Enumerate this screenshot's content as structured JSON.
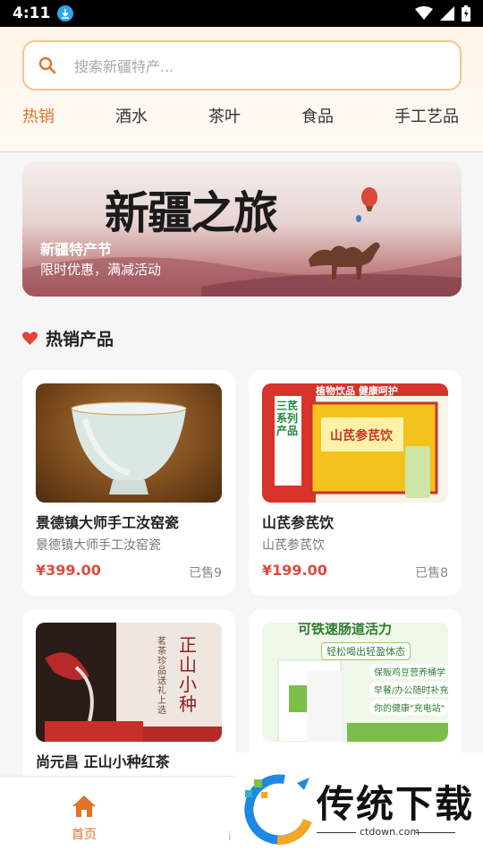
{
  "status_bar": {
    "time": "4:11"
  },
  "search": {
    "placeholder": "搜索新疆特产..."
  },
  "tabs": [
    {
      "label": "热销",
      "active": true
    },
    {
      "label": "酒水",
      "active": false
    },
    {
      "label": "茶叶",
      "active": false
    },
    {
      "label": "食品",
      "active": false
    },
    {
      "label": "手工艺品",
      "active": false
    }
  ],
  "banner": {
    "calligraphy": "新疆之旅",
    "title": "新疆特产节",
    "subtitle": "限时优惠，满减活动"
  },
  "section": {
    "title": "热销产品"
  },
  "products": [
    {
      "name": "景德镇大师手工汝窑瓷",
      "desc": "景德镇大师手工汝窑瓷",
      "price": "¥399.00",
      "sold": "已售9"
    },
    {
      "name": "山芪参芪饮",
      "desc": "山芪参芪饮",
      "price": "¥199.00",
      "sold": "已售8"
    },
    {
      "name": "尚元昌 正山小种红茶",
      "desc": "",
      "price": "",
      "sold": ""
    },
    {
      "name": "",
      "desc": "",
      "price": "",
      "sold": ""
    }
  ],
  "product_images": {
    "p2_box_label": "山芪参芪饮",
    "p2_side_label": "三芪系列产品",
    "p2_top_label": "植物饮品 健康呵护",
    "p3_vertical_title": "正山小种",
    "p3_vertical_sub": "茗茶珍品 送礼上选",
    "p4_headline": "可铁速肠道活力",
    "p4_tag": "轻松喝出轻盈体态",
    "p4_line1": "保販鸡豆营养桶学",
    "p4_line2": "早餐/办公随时补充",
    "p4_line3": "你的健康\"充电站\""
  },
  "bottom_nav": {
    "home_label": "首页",
    "faded_char": "i"
  },
  "watermark": {
    "brand": "传统下载",
    "url": "ctdown.com"
  },
  "colors": {
    "accent": "#e4722a",
    "price": "#e04b3b",
    "heart": "#e8403a"
  }
}
